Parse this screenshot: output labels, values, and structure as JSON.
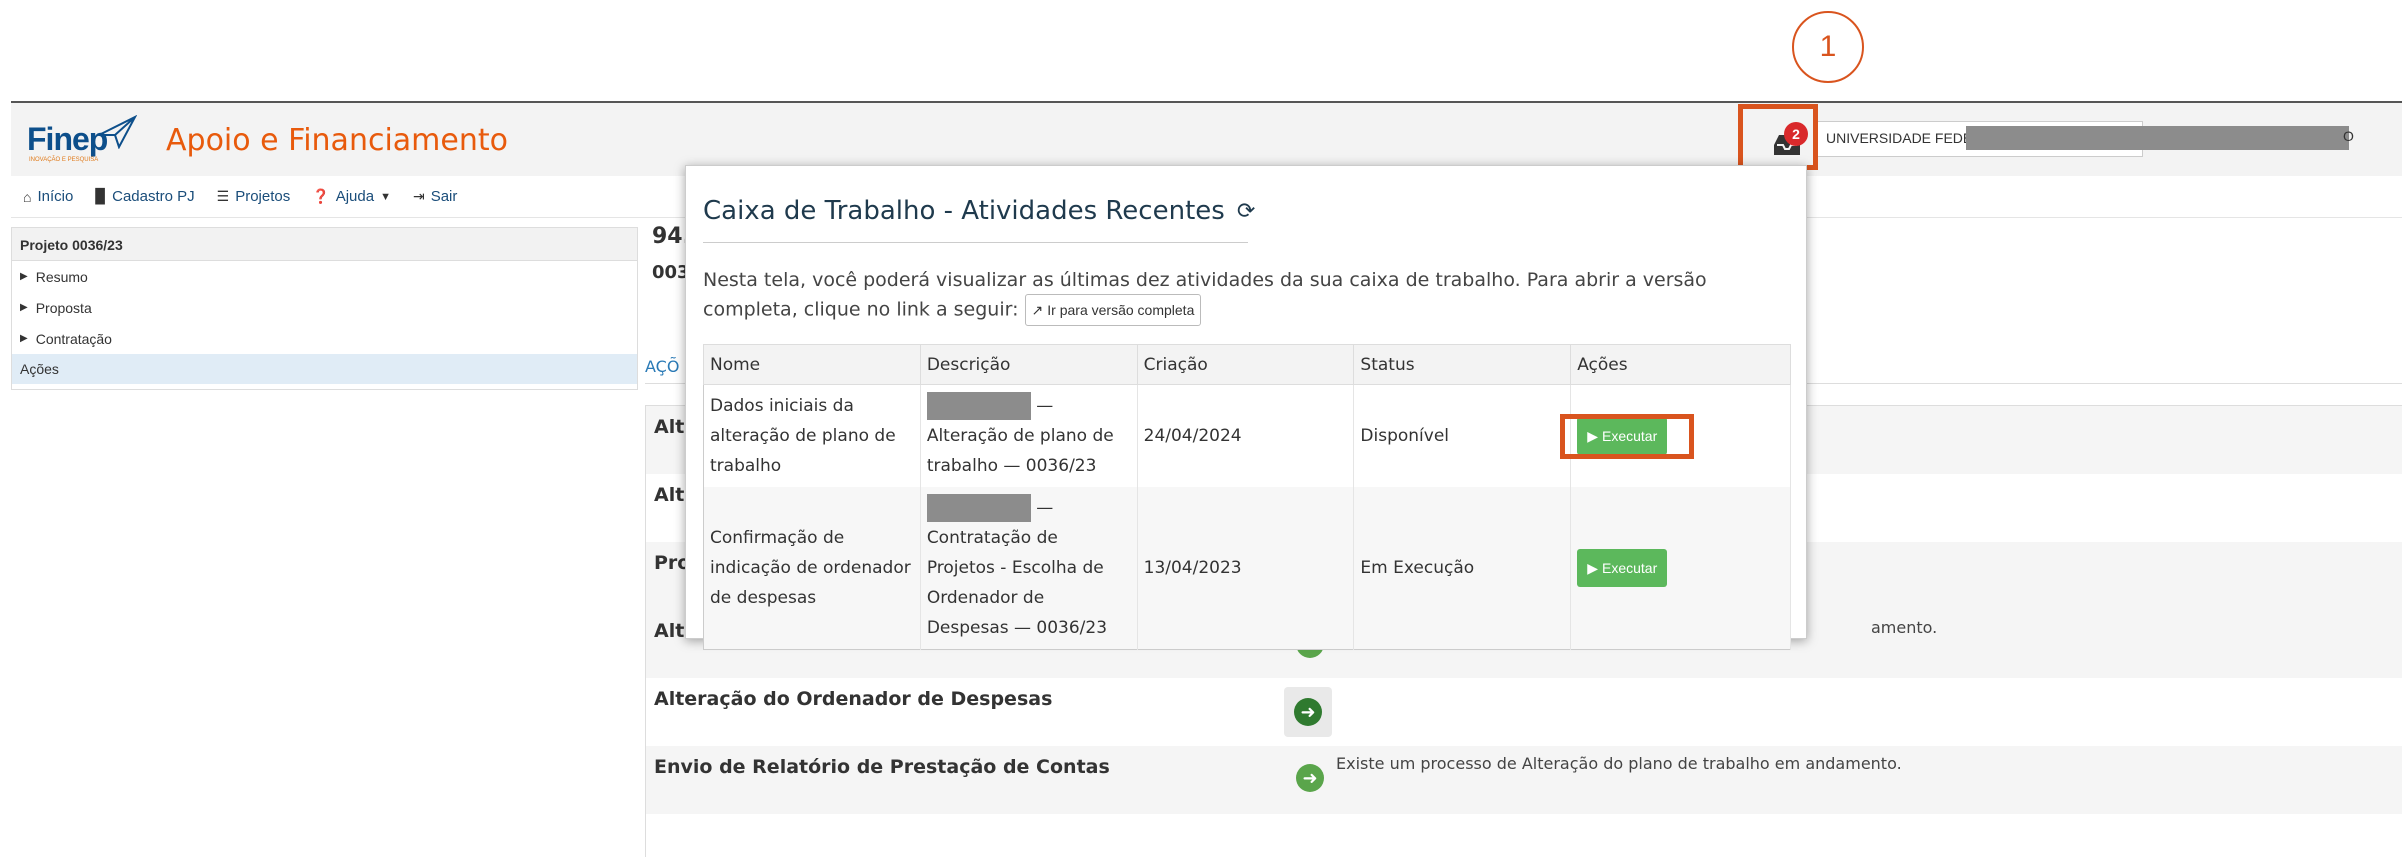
{
  "annotations": {
    "marker1": "1",
    "marker2": "2"
  },
  "header": {
    "logo_text": "Finep",
    "logo_sub": "INOVAÇÃO E PESQUISA",
    "app_title": "Apoio e Financiamento",
    "notification_count": "2",
    "org_name": "UNIVERSIDADE FEDE",
    "org_suffix": "O"
  },
  "nav": {
    "items": [
      {
        "label": "Início",
        "icon": "home-icon"
      },
      {
        "label": "Cadastro PJ",
        "icon": "building-icon"
      },
      {
        "label": "Projetos",
        "icon": "list-icon"
      },
      {
        "label": "Ajuda",
        "icon": "question-icon"
      },
      {
        "label": "Sair",
        "icon": "sign-out-icon"
      }
    ]
  },
  "sidebar": {
    "title": "Projeto 0036/23",
    "items": [
      {
        "label": "Resumo"
      },
      {
        "label": "Proposta"
      },
      {
        "label": "Contratação"
      },
      {
        "label": "Ações"
      }
    ]
  },
  "main": {
    "title_fragment": "94.",
    "subtitle_fragment": "003",
    "active_tab": "AÇÕ",
    "rows": [
      {
        "label": "Alte"
      },
      {
        "label": "Alte"
      },
      {
        "label": "Pro"
      },
      {
        "label": "Alte",
        "note": "amento."
      },
      {
        "label": "Alteração do Ordenador de Despesas"
      },
      {
        "label": "Envio de Relatório de Prestação de Contas",
        "note": "Existe um processo de Alteração do plano de trabalho em andamento."
      }
    ]
  },
  "popup": {
    "title": "Caixa de Trabalho - Atividades Recentes",
    "description": "Nesta tela, você poderá visualizar as últimas dez atividades da sua caixa de trabalho. Para abrir a versão completa, clique no link a seguir:",
    "full_version_link": "Ir para versão completa",
    "columns": [
      "Nome",
      "Descrição",
      "Criação",
      "Status",
      "Ações"
    ],
    "rows": [
      {
        "name": "Dados iniciais da alteração de plano de trabalho",
        "description_a": "— Alteração",
        "description_b": "de plano de trabalho — 0036/23",
        "created": "24/04/2024",
        "status": "Disponível",
        "action": "Executar"
      },
      {
        "name": "Confirmação de indicação de ordenador de despesas",
        "description_a": "—",
        "description_b": "Contratação de Projetos - Escolha de Ordenador de Despesas — 0036/23",
        "created": "13/04/2023",
        "status": "Em Execução",
        "action": "Executar"
      }
    ]
  },
  "colors": {
    "accent_orange": "#d9541e",
    "brand_blue": "#0d4f8b",
    "success_green": "#5cb85c",
    "badge_red": "#d9292b"
  }
}
